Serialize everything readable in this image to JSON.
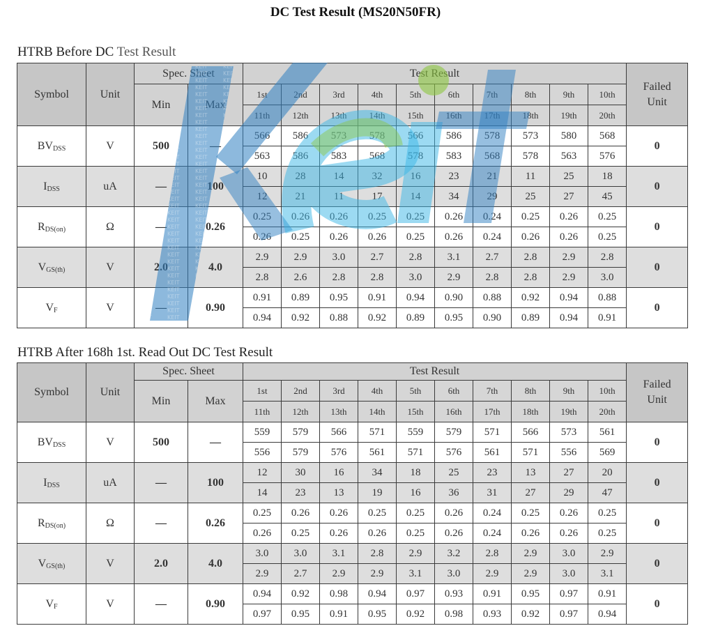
{
  "title": "DC Test Result (MS20N50FR)",
  "sections": [
    {
      "title_main": "HTRB Before DC",
      "title_rest": " Test Result",
      "headers": {
        "symbol": "Symbol",
        "unit": "Unit",
        "spec_sheet": "Spec. Sheet",
        "min": "Min",
        "max": "Max",
        "test_result": "Test Result",
        "failed_unit": "Failed Unit",
        "samples_row1": [
          "1st",
          "2nd",
          "3rd",
          "4th",
          "5th",
          "6th",
          "7th",
          "8th",
          "9th",
          "10th"
        ],
        "samples_row2": [
          "11th",
          "12th",
          "13th",
          "14th",
          "15th",
          "16th",
          "17th",
          "18th",
          "19th",
          "20th"
        ]
      },
      "rows": [
        {
          "symbol": "BV",
          "sub": "DSS",
          "unit": "V",
          "min": "500",
          "max": "—",
          "r1": [
            "566",
            "586",
            "573",
            "578",
            "566",
            "586",
            "578",
            "573",
            "580",
            "568"
          ],
          "r2": [
            "563",
            "586",
            "583",
            "568",
            "578",
            "583",
            "568",
            "578",
            "563",
            "576"
          ],
          "failed": "0"
        },
        {
          "symbol": "I",
          "sub": "DSS",
          "unit": "uA",
          "min": "—",
          "max": "100",
          "r1": [
            "10",
            "28",
            "14",
            "32",
            "16",
            "23",
            "21",
            "11",
            "25",
            "18"
          ],
          "r2": [
            "12",
            "21",
            "11",
            "17",
            "14",
            "34",
            "29",
            "25",
            "27",
            "45"
          ],
          "failed": "0"
        },
        {
          "symbol": "R",
          "sub": "DS(on)",
          "unit": "Ω",
          "min": "—",
          "max": "0.26",
          "r1": [
            "0.25",
            "0.26",
            "0.26",
            "0.25",
            "0.25",
            "0.26",
            "0.24",
            "0.25",
            "0.26",
            "0.25"
          ],
          "r2": [
            "0.26",
            "0.25",
            "0.26",
            "0.26",
            "0.25",
            "0.26",
            "0.24",
            "0.26",
            "0.26",
            "0.25"
          ],
          "failed": "0"
        },
        {
          "symbol": "V",
          "sub": "GS(th)",
          "unit": "V",
          "min": "2.0",
          "max": "4.0",
          "r1": [
            "2.9",
            "2.9",
            "3.0",
            "2.7",
            "2.8",
            "3.1",
            "2.7",
            "2.8",
            "2.9",
            "2.8"
          ],
          "r2": [
            "2.8",
            "2.6",
            "2.8",
            "2.8",
            "3.0",
            "2.9",
            "2.8",
            "2.8",
            "2.9",
            "3.0"
          ],
          "failed": "0"
        },
        {
          "symbol": "V",
          "sub": "F",
          "unit": "V",
          "min": "—",
          "max": "0.90",
          "r1": [
            "0.91",
            "0.89",
            "0.95",
            "0.91",
            "0.94",
            "0.90",
            "0.88",
            "0.92",
            "0.94",
            "0.88"
          ],
          "r2": [
            "0.94",
            "0.92",
            "0.88",
            "0.92",
            "0.89",
            "0.95",
            "0.90",
            "0.89",
            "0.94",
            "0.91"
          ],
          "failed": "0"
        }
      ]
    },
    {
      "title_main": "HTRB After 168h 1st. Read Out DC Test Result",
      "title_rest": "",
      "headers": {
        "symbol": "Symbol",
        "unit": "Unit",
        "spec_sheet": "Spec. Sheet",
        "min": "Min",
        "max": "Max",
        "test_result": "Test Result",
        "failed_unit": "Failed Unit",
        "samples_row1": [
          "1st",
          "2nd",
          "3rd",
          "4th",
          "5th",
          "6th",
          "7th",
          "8th",
          "9th",
          "10th"
        ],
        "samples_row2": [
          "11th",
          "12th",
          "13th",
          "14th",
          "15th",
          "16th",
          "17th",
          "18th",
          "19th",
          "20th"
        ]
      },
      "rows": [
        {
          "symbol": "BV",
          "sub": "DSS",
          "unit": "V",
          "min": "500",
          "max": "—",
          "r1": [
            "559",
            "579",
            "566",
            "571",
            "559",
            "579",
            "571",
            "566",
            "573",
            "561"
          ],
          "r2": [
            "556",
            "579",
            "576",
            "561",
            "571",
            "576",
            "561",
            "571",
            "556",
            "569"
          ],
          "failed": "0"
        },
        {
          "symbol": "I",
          "sub": "DSS",
          "unit": "uA",
          "min": "—",
          "max": "100",
          "r1": [
            "12",
            "30",
            "16",
            "34",
            "18",
            "25",
            "23",
            "13",
            "27",
            "20"
          ],
          "r2": [
            "14",
            "23",
            "13",
            "19",
            "16",
            "36",
            "31",
            "27",
            "29",
            "47"
          ],
          "failed": "0"
        },
        {
          "symbol": "R",
          "sub": "DS(on)",
          "unit": "Ω",
          "min": "—",
          "max": "0.26",
          "r1": [
            "0.25",
            "0.26",
            "0.26",
            "0.25",
            "0.25",
            "0.26",
            "0.24",
            "0.25",
            "0.26",
            "0.25"
          ],
          "r2": [
            "0.26",
            "0.25",
            "0.26",
            "0.26",
            "0.25",
            "0.26",
            "0.24",
            "0.26",
            "0.26",
            "0.25"
          ],
          "failed": "0"
        },
        {
          "symbol": "V",
          "sub": "GS(th)",
          "unit": "V",
          "min": "2.0",
          "max": "4.0",
          "r1": [
            "3.0",
            "3.0",
            "3.1",
            "2.8",
            "2.9",
            "3.2",
            "2.8",
            "2.9",
            "3.0",
            "2.9"
          ],
          "r2": [
            "2.9",
            "2.7",
            "2.9",
            "2.9",
            "3.1",
            "3.0",
            "2.9",
            "2.9",
            "3.0",
            "3.1"
          ],
          "failed": "0"
        },
        {
          "symbol": "V",
          "sub": "F",
          "unit": "V",
          "min": "—",
          "max": "0.90",
          "r1": [
            "0.94",
            "0.92",
            "0.98",
            "0.94",
            "0.97",
            "0.93",
            "0.91",
            "0.95",
            "0.97",
            "0.91"
          ],
          "r2": [
            "0.97",
            "0.95",
            "0.91",
            "0.95",
            "0.92",
            "0.98",
            "0.93",
            "0.92",
            "0.97",
            "0.94"
          ],
          "failed": "0"
        }
      ]
    }
  ],
  "watermark": {
    "text": "Keit",
    "pattern_text": "KEIT",
    "colors": {
      "blue": "#2f7fc1",
      "green": "#8cc63f",
      "cyan": "#39b5e6"
    }
  },
  "styles": {
    "header_bg": "#c9c9c9",
    "gray_row_bg": "#dedede",
    "border": "#3a3a3a"
  }
}
